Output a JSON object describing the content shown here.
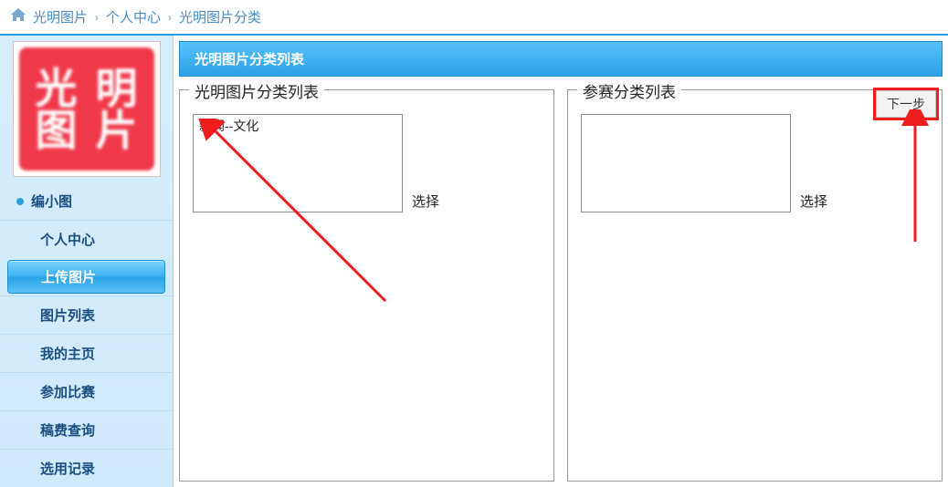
{
  "breadcrumb": {
    "item1": "光明图片",
    "item2": "个人中心",
    "item3": "光明图片分类"
  },
  "logo": {
    "c1": "光",
    "c2": "明",
    "c3": "图",
    "c4": "片"
  },
  "sidebar": {
    "user_name": "编小图",
    "items": {
      "0": "个人中心",
      "1": "上传图片",
      "2": "图片列表",
      "3": "我的主页",
      "4": "参加比赛",
      "5": "稿费查询",
      "6": "选用记录"
    }
  },
  "content": {
    "header": "光明图片分类列表",
    "panel1": {
      "legend": "光明图片分类列表",
      "item0": "新闻--文化",
      "select_label": "选择"
    },
    "panel2": {
      "legend": "参赛分类列表",
      "select_label": "选择"
    },
    "next_button": "下一步"
  }
}
